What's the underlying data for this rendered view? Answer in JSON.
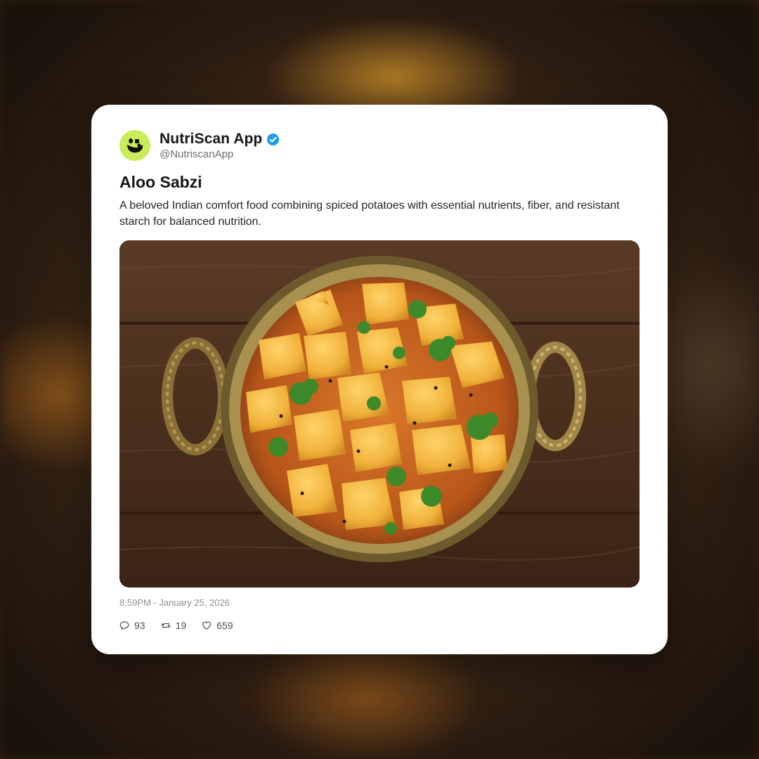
{
  "post": {
    "account_name": "NutriScan App",
    "handle": "@NutriscanApp",
    "verified": true,
    "avatar_icon": "leaf-logo-icon",
    "title": "Aloo Sabzi",
    "description": "A beloved Indian comfort food combining spiced potatoes with essential nutrients, fiber, and resistant starch for balanced nutrition.",
    "image_icon": "aloo-sabzi-photo",
    "timestamp": "8:59PM - January 25, 2026",
    "stats": {
      "replies": "93",
      "retweets": "19",
      "likes": "659"
    }
  },
  "colors": {
    "avatar_bg": "#c8ec5a",
    "verified_badge": "#1d9bf0",
    "card_bg": "#ffffff"
  }
}
